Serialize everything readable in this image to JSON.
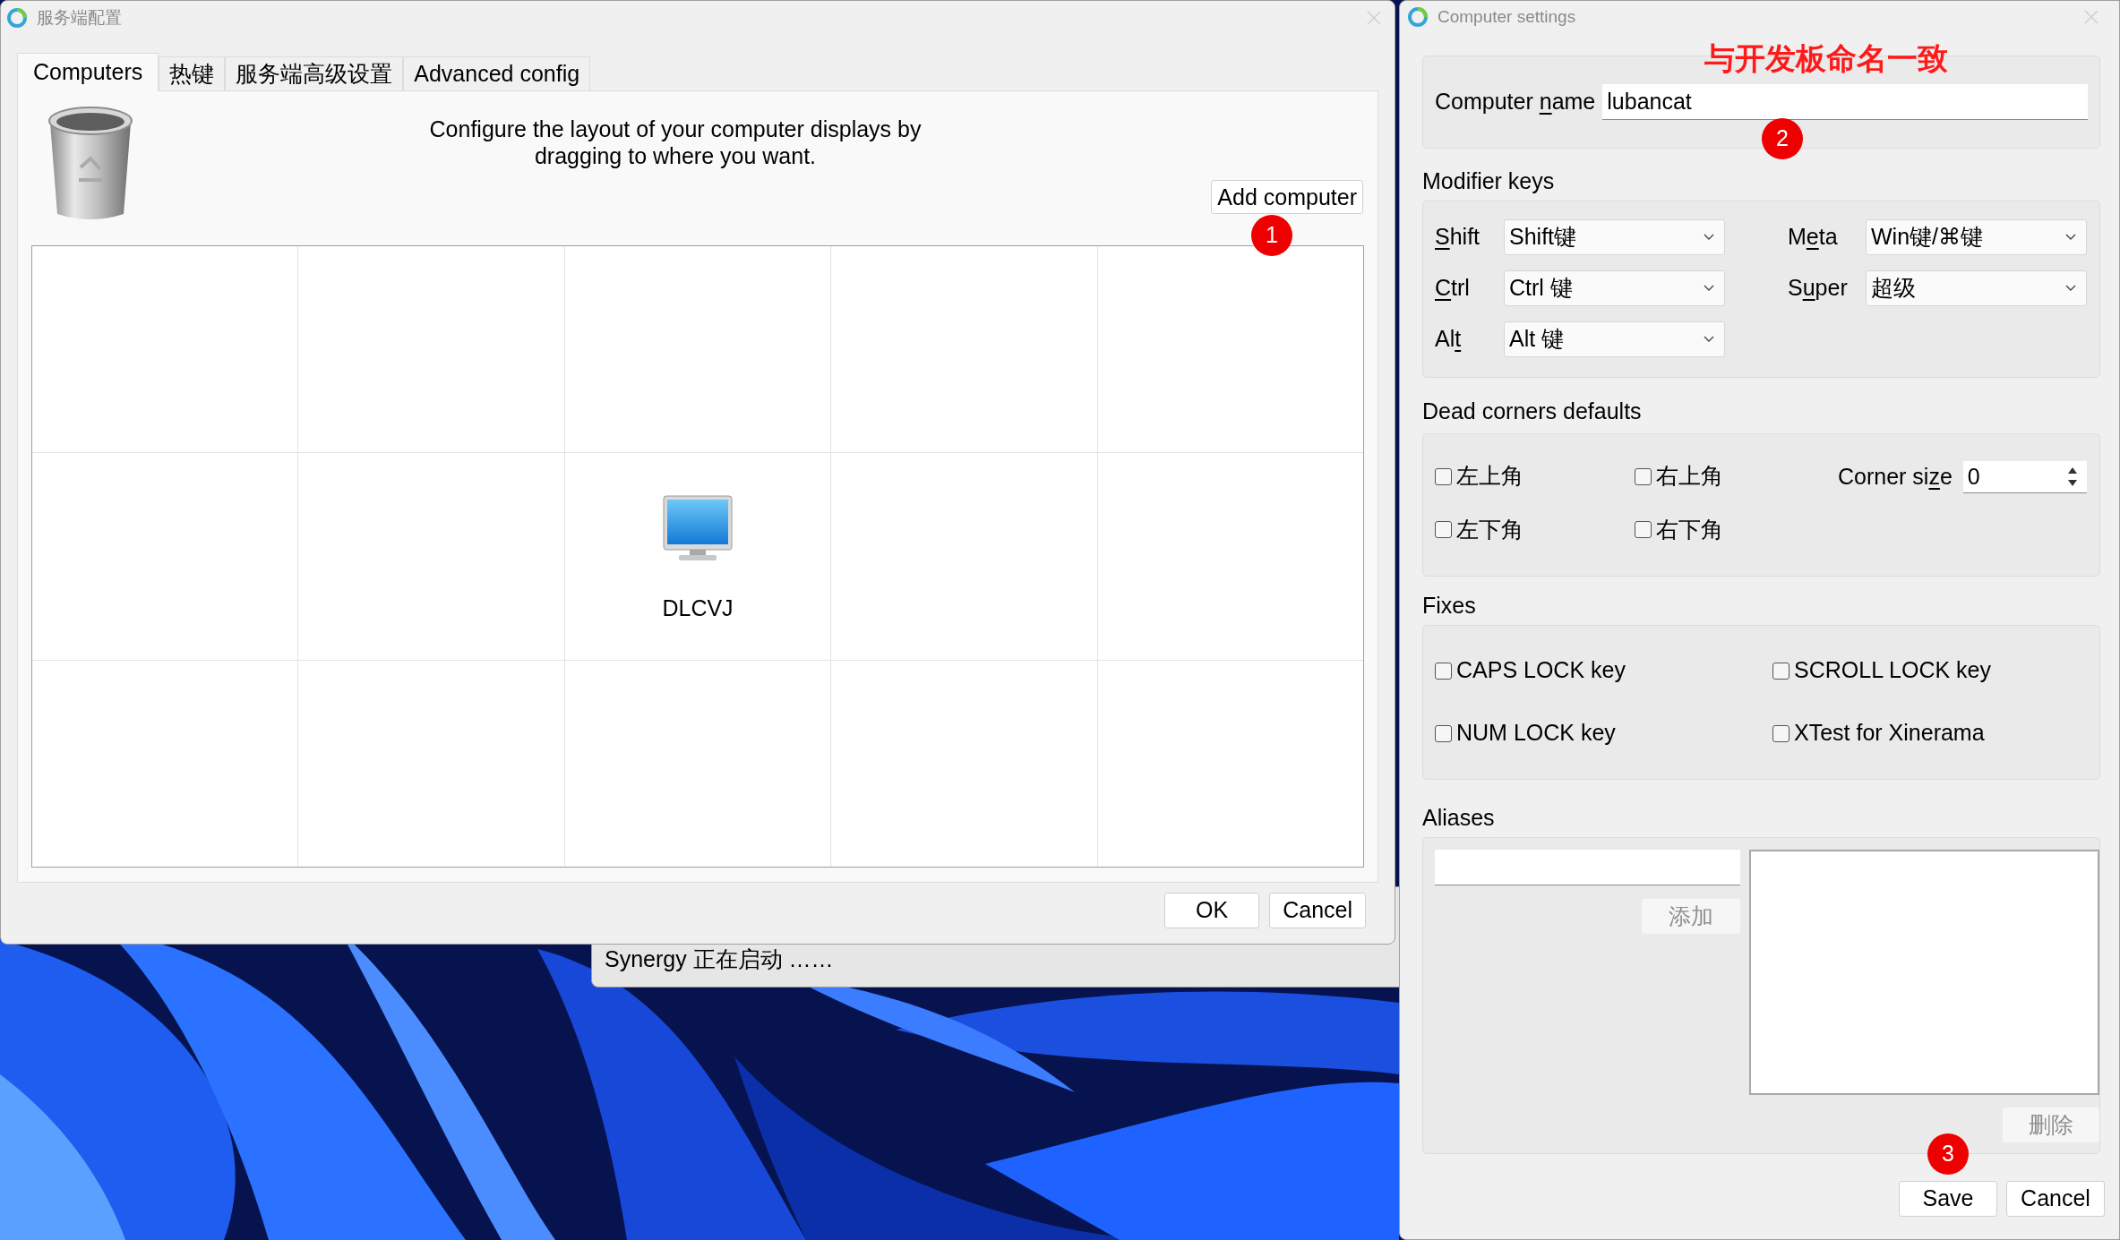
{
  "server_window": {
    "title": "服务端配置",
    "tabs": [
      {
        "label": "Computers",
        "selected": true
      },
      {
        "label": "热键",
        "selected": false
      },
      {
        "label": "服务端高级设置",
        "selected": false
      },
      {
        "label": "Advanced config",
        "selected": false
      }
    ],
    "instructions": "Configure the layout of your computer displays by dragging to where you want.",
    "add_button": "Add computer",
    "grid": [
      [
        {
          "kind": "empty"
        },
        {
          "kind": "empty"
        },
        {
          "kind": "empty"
        },
        {
          "kind": "empty"
        },
        {
          "kind": "empty"
        }
      ],
      [
        {
          "kind": "empty"
        },
        {
          "kind": "empty"
        },
        {
          "kind": "computer",
          "name": "DLCVJ"
        },
        {
          "kind": "empty"
        },
        {
          "kind": "empty"
        }
      ],
      [
        {
          "kind": "empty"
        },
        {
          "kind": "empty"
        },
        {
          "kind": "empty"
        },
        {
          "kind": "empty"
        },
        {
          "kind": "empty"
        }
      ]
    ],
    "buttons": [
      "OK",
      "Cancel"
    ]
  },
  "status_window": {
    "message": "Synergy 正在启动 ……"
  },
  "settings_window": {
    "title": "Computer settings",
    "computer_name": {
      "label_parts": {
        "before": "Computer ",
        "key": "n",
        "after": "ame"
      },
      "value": "lubancat"
    },
    "modifier_keys": {
      "heading": "Modifier keys",
      "rows": [
        [
          {
            "label_parts": {
              "key": "S",
              "after": "hift"
            },
            "value": "Shift键"
          },
          {
            "label_parts": {
              "before": "M",
              "key": "e",
              "after": "ta"
            },
            "value": "Win键/⌘键"
          }
        ],
        [
          {
            "label_parts": {
              "key": "C",
              "after": "trl"
            },
            "value": "Ctrl 键"
          },
          {
            "label_parts": {
              "before": "S",
              "key": "u",
              "after": "per"
            },
            "value": "超级"
          }
        ],
        [
          {
            "label_parts": {
              "before": "Al",
              "key": "t"
            },
            "value": "Alt 键"
          }
        ]
      ]
    },
    "dead_corners": {
      "heading": "Dead corners defaults",
      "checkboxes": [
        {
          "label": "左上角",
          "checked": false
        },
        {
          "label": "右上角",
          "checked": false
        },
        {
          "label": "左下角",
          "checked": false
        },
        {
          "label": "右下角",
          "checked": false
        }
      ],
      "corner_size": {
        "label_parts": {
          "before": "Corner si",
          "key": "z",
          "after": "e"
        },
        "value": "0"
      }
    },
    "fixes": {
      "heading": "Fixes",
      "checkboxes": [
        {
          "label": "CAPS LOCK key",
          "checked": false
        },
        {
          "label": "SCROLL LOCK key",
          "checked": false
        },
        {
          "label": "NUM LOCK key",
          "checked": false
        },
        {
          "label": "XTest for Xinerama",
          "checked": false
        }
      ]
    },
    "aliases": {
      "heading": "Aliases",
      "add_button": {
        "label": "添加",
        "disabled": true
      },
      "remove_button": {
        "label": "删除",
        "disabled": true
      }
    },
    "buttons": [
      "Save",
      "Cancel"
    ]
  },
  "annotations": {
    "note": "与开发板命名一致",
    "badges": [
      "1",
      "2",
      "3"
    ]
  }
}
